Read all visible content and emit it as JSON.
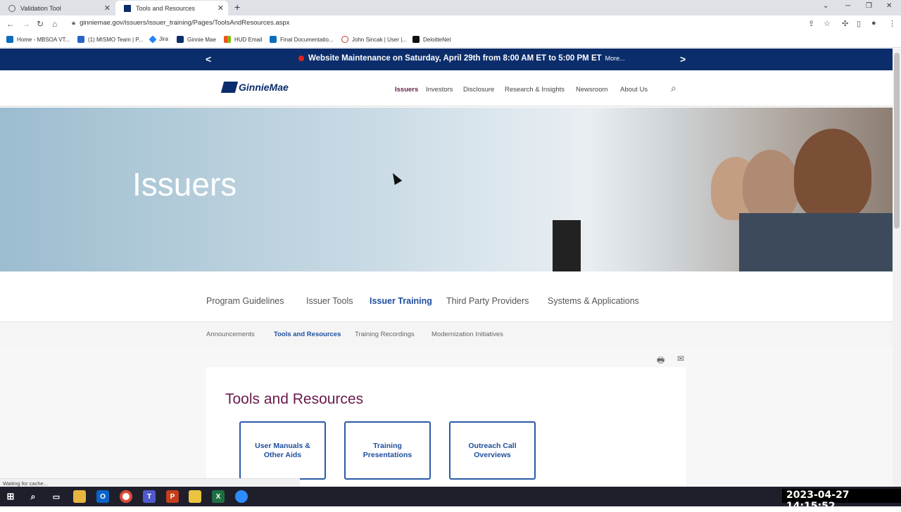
{
  "browser": {
    "tabs": [
      {
        "title": "Validation Tool",
        "active": false
      },
      {
        "title": "Tools and Resources",
        "active": true
      }
    ],
    "url": "ginniemae.gov/issuers/issuer_training/Pages/ToolsAndResources.aspx",
    "bookmarks": [
      "Home - MBSOA VT...",
      "(1) MISMO Team | P...",
      "Jira",
      "Ginnie Mae",
      "HUD Email",
      "Final Documentatio...",
      "John Sincak | User |...",
      "DeloitteNet"
    ],
    "status_text": "Waiting for cache..."
  },
  "banner": {
    "message": "Website Maintenance on Saturday, April 29th from 8:00 AM ET to 5:00 PM ET",
    "more": "More...",
    "prev": "<",
    "next": ">"
  },
  "header": {
    "logo_text": "GinnieMae",
    "nav": [
      "Issuers",
      "Investors",
      "Disclosure",
      "Research & Insights",
      "Newsroom",
      "About Us"
    ],
    "active_nav": "Issuers"
  },
  "hero": {
    "title": "Issuers"
  },
  "section_nav": {
    "items": [
      "Program Guidelines",
      "Issuer Tools",
      "Issuer Training",
      "Third Party Providers",
      "Systems & Applications"
    ],
    "active": "Issuer Training"
  },
  "sub_nav": {
    "items": [
      "Announcements",
      "Tools and Resources",
      "Training Recordings",
      "Modernization Initiatives"
    ],
    "active": "Tools and Resources"
  },
  "content": {
    "title": "Tools and Resources",
    "tiles": [
      "User Manuals & Other Aids",
      "Training Presentations",
      "Outreach Call Overviews"
    ]
  },
  "taskbar": {
    "clock": "2023-04-27  14:15:52"
  },
  "colors": {
    "banner_bg": "#0b2d6b",
    "accent_purple": "#6a1a4c",
    "link_blue": "#1e4e9c"
  }
}
